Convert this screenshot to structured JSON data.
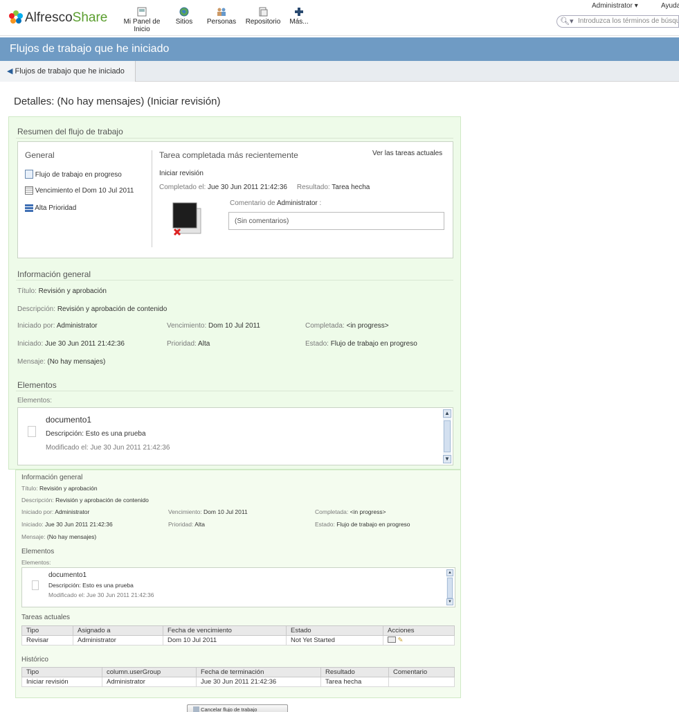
{
  "header": {
    "logo_text": "Alfresco",
    "logo_text2": "Share",
    "nav": [
      {
        "label": "Mi Panel de Inicio",
        "icon": "dashboard-icon"
      },
      {
        "label": "Sitios",
        "icon": "globe-icon"
      },
      {
        "label": "Personas",
        "icon": "people-icon"
      },
      {
        "label": "Repositorio",
        "icon": "repository-icon"
      },
      {
        "label": "Más...",
        "icon": "plus-icon"
      }
    ],
    "user": "Administrator",
    "help": "Ayuda",
    "search_placeholder": "Introduzca los términos de búsqueda"
  },
  "titlebar": {
    "title": "Flujos de trabajo que he iniciado"
  },
  "backbar": {
    "label": "Flujos de trabajo que he iniciado"
  },
  "page": {
    "heading": "Detalles: (No hay mensajes) (Iniciar revisión)"
  },
  "summary": {
    "title": "Resumen del flujo de trabajo",
    "general_title": "General",
    "general_items": [
      "Flujo de trabajo en progreso",
      "Vencimiento el Dom 10 Jul 2011",
      "Alta Prioridad"
    ],
    "recent_title": "Tarea completada más recientemente",
    "view_current": "Ver las tareas actuales",
    "task_name": "Iniciar revisión",
    "completed_label": "Completado el:",
    "completed_value": "Jue 30 Jun 2011 21:42:36",
    "result_label": "Resultado:",
    "result_value": "Tarea hecha",
    "comment_label": "Comentario de",
    "comment_user": "Administrator",
    "comment_colon": ":",
    "comment_text": "(Sin comentarios)"
  },
  "info": {
    "title": "Información general",
    "titulo_label": "Título:",
    "titulo_value": "Revisión y aprobación",
    "desc_label": "Descripción:",
    "desc_value": "Revisión y aprobación de contenido",
    "iniciado_por_label": "Iniciado por:",
    "iniciado_por_value": "Administrator",
    "vencimiento_label": "Vencimiento:",
    "vencimiento_value": "Dom 10 Jul 2011",
    "completada_label": "Completada:",
    "completada_value": "<in progress>",
    "iniciado_label": "Iniciado:",
    "iniciado_value": "Jue 30 Jun 2011 21:42:36",
    "prioridad_label": "Prioridad:",
    "prioridad_value": "Alta",
    "estado_label": "Estado:",
    "estado_value": "Flujo de trabajo en progreso",
    "mensaje_label": "Mensaje:",
    "mensaje_value": "(No hay mensajes)"
  },
  "items": {
    "title": "Elementos",
    "label": "Elementos:",
    "doc_name": "documento1",
    "doc_desc": "Descripción: Esto es una prueba",
    "doc_mod": "Modificado el: Jue 30 Jun 2011 21:42:36"
  },
  "current_tasks": {
    "title": "Tareas actuales",
    "headers": [
      "Tipo",
      "Asignado a",
      "Fecha de vencimiento",
      "Estado",
      "Acciones"
    ],
    "rows": [
      [
        "Revisar",
        "Administrator",
        "Dom 10 Jul 2011",
        "Not Yet Started"
      ]
    ]
  },
  "history": {
    "title": "Histórico",
    "headers": [
      "Tipo",
      "column.userGroup",
      "Fecha de terminación",
      "Resultado",
      "Comentario"
    ],
    "rows": [
      [
        "Iniciar revisión",
        "Administrator",
        "Jue 30 Jun 2011 21:42:36",
        "Tarea hecha",
        ""
      ]
    ]
  },
  "footer": {
    "cancel_label": "Cancelar flujo de trabajo"
  }
}
